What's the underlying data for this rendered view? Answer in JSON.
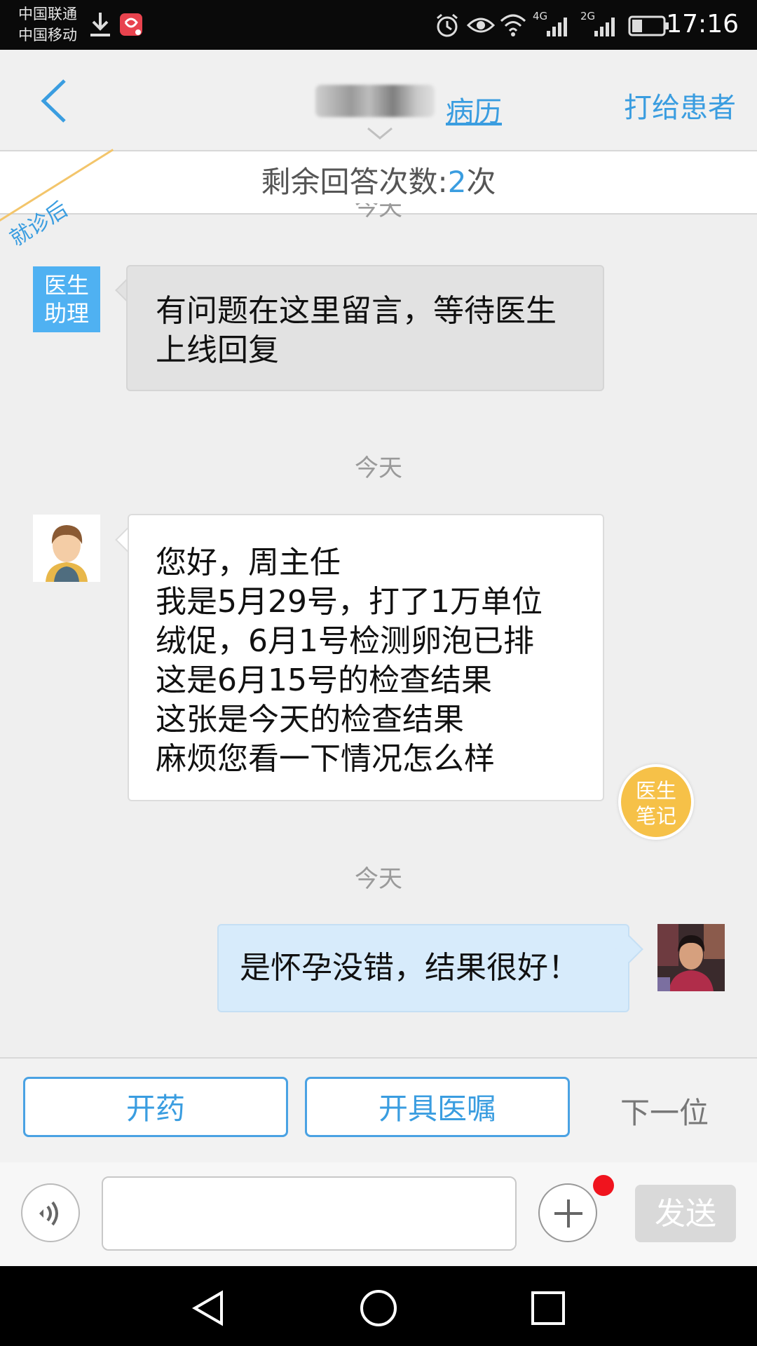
{
  "status_bar": {
    "carrier_1": "中国联通",
    "carrier_2": "中国移动",
    "network_1": "4G",
    "network_2": "2G",
    "time": "17:16",
    "icons": [
      "download-icon",
      "app-notification-icon",
      "alarm-icon",
      "eye-icon",
      "wifi-icon",
      "signal-icon",
      "signal-icon",
      "battery-icon"
    ]
  },
  "nav": {
    "back_icon": "chevron-left-icon",
    "record_link": "病历",
    "call_label": "打给患者"
  },
  "remaining": {
    "prefix": "剩余回答次数:",
    "count": "2",
    "suffix": "次"
  },
  "ribbon_label": "就诊后",
  "messages": {
    "partial_time": "今天",
    "assistant": {
      "avatar_label": "医生助理",
      "text": "有问题在这里留言，等待医生上线回复"
    },
    "time_1": "今天",
    "patient": {
      "lines": [
        "您好，周主任",
        "我是5月29号，打了1万单位",
        "绒促，6月1号检测卵泡已排",
        "这是6月15号的检查结果",
        "这张是今天的检查结果",
        "麻烦您看一下情况怎么样"
      ]
    },
    "doctor_note_label": "医生笔记",
    "time_2": "今天",
    "doctor_reply": {
      "text": "是怀孕没错，结果很好！"
    }
  },
  "actions": {
    "prescribe": "开药",
    "orders": "开具医嘱",
    "next": "下一位"
  },
  "input": {
    "value": "",
    "placeholder": "",
    "send_label": "发送"
  },
  "colors": {
    "accent": "#3a9de0",
    "assistant_badge": "#4fb1f2",
    "note_badge": "#f6c148",
    "reply_bubble": "#d7ebfb",
    "unread_dot": "#f0141e"
  }
}
